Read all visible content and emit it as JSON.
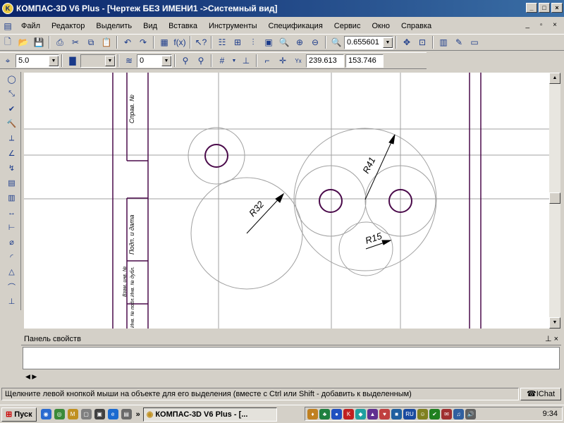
{
  "window": {
    "title": "КОМПАС-3D V6 Plus - [Чертеж БЕЗ ИМЕНИ1 ->Системный вид]"
  },
  "menu": {
    "items": [
      "Файл",
      "Редактор",
      "Выделить",
      "Вид",
      "Вставка",
      "Инструменты",
      "Спецификация",
      "Сервис",
      "Окно",
      "Справка"
    ]
  },
  "toolbar": {
    "zoom_value": "0.655601"
  },
  "params": {
    "line_width": "5.0",
    "layer": "0",
    "coord_x": "239.613",
    "coord_y": "153.746"
  },
  "drawing": {
    "dims": [
      "R32",
      "R41",
      "R15"
    ],
    "stamp_labels": [
      "Справ. №",
      "Подп. и дата",
      "Инв. № дубл.",
      "Взам. инв. №",
      "Инв. № подл."
    ]
  },
  "props_panel": {
    "title": "Панель свойств"
  },
  "status": {
    "text": "Щелкните левой кнопкой мыши на объекте для его выделения (вместе с Ctrl или Shift - добавить к выделенным)",
    "chat_label": "IChat"
  },
  "taskbar": {
    "start_label": "Пуск",
    "app_label": "КОМПАС-3D V6 Plus - [...",
    "more_label": "»",
    "lang": "RU",
    "clock": "9:34"
  },
  "colors": {
    "title_start": "#0a246a",
    "circle_accent": "#4a0a4a",
    "guide": "#a0a0a0"
  }
}
